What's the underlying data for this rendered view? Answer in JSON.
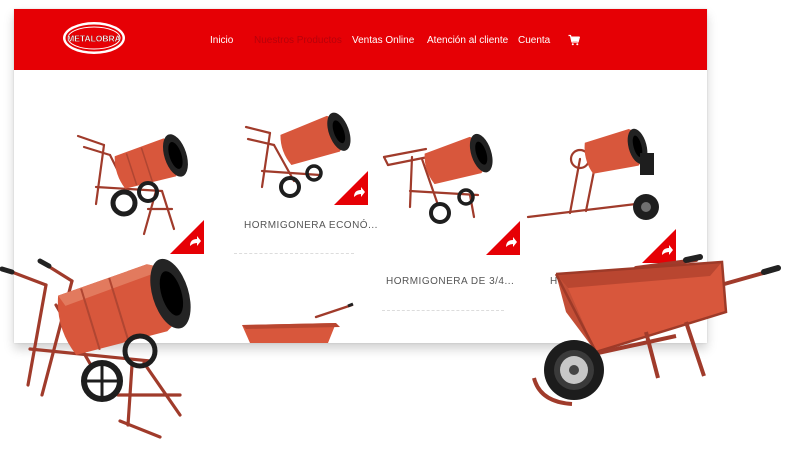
{
  "header": {
    "logo_text": "METALOBRA",
    "nav": [
      {
        "label": "Inicio"
      },
      {
        "label": "Nuestros Productos"
      },
      {
        "label": "Ventas Online"
      },
      {
        "label": "Atención al cliente"
      },
      {
        "label": "Cuenta"
      }
    ],
    "cart_icon": "cart-icon"
  },
  "products": [
    {
      "title": ""
    },
    {
      "title": "HORMIGONERA ECONÓ..."
    },
    {
      "title": "HORMIGONERA DE 3/4..."
    },
    {
      "title": "HORMIG"
    }
  ],
  "colors": {
    "brand_red": "#e60005",
    "machine_orange": "#d8573c",
    "frame_dark": "#9b3a2a"
  }
}
